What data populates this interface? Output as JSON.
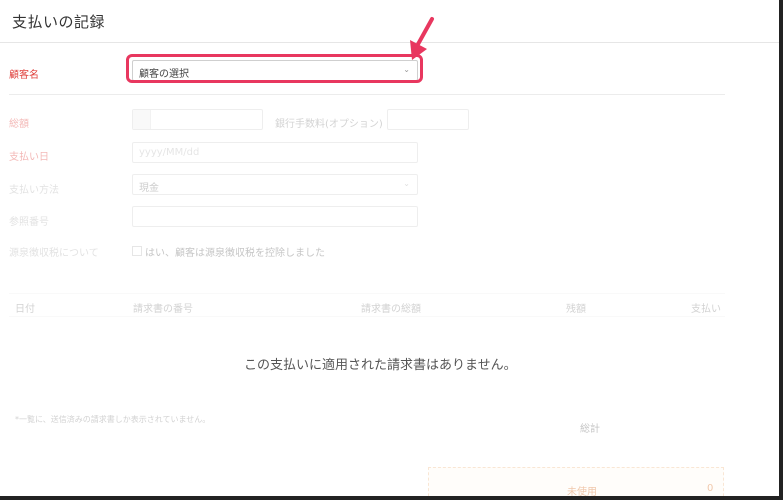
{
  "header": {
    "title": "支払いの記録"
  },
  "form": {
    "customer": {
      "label": "顧客名",
      "value": "顧客の選択"
    },
    "amount": {
      "label": "総額",
      "value": ""
    },
    "bank_fee": {
      "label": "銀行手数料(オプション)",
      "value": ""
    },
    "payment_date": {
      "label": "支払い日",
      "placeholder": "yyyy/MM/dd"
    },
    "payment_method": {
      "label": "支払い方法",
      "value": "現金"
    },
    "reference": {
      "label": "参照番号",
      "value": ""
    },
    "tax": {
      "label": "源泉徴収税について",
      "checkbox_label": "はい、顧客は源泉徴収税を控除しました",
      "checked": false
    }
  },
  "table": {
    "columns": [
      "日付",
      "請求書の番号",
      "請求書の総額",
      "残額",
      "支払い"
    ],
    "empty_message": "この支払いに適用された請求書はありません。"
  },
  "footnote": "*一覧に、送信済みの請求書しか表示されていません。",
  "totals": {
    "total_label": "総計",
    "unpaid_label": "未使用",
    "unpaid_value": "0"
  },
  "colors": {
    "highlight": "#e8375f",
    "required_label": "#e0433f",
    "unpaid_text": "#d8722c"
  }
}
